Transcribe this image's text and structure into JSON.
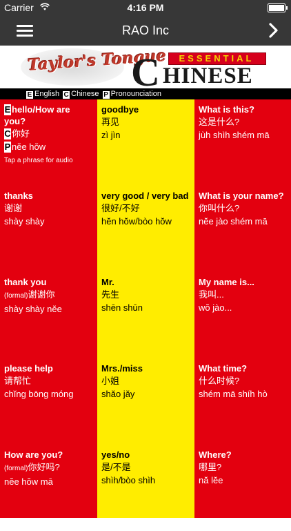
{
  "status": {
    "carrier": "Carrier",
    "time": "4:16 PM"
  },
  "nav": {
    "title": "RAO Inc"
  },
  "banner": {
    "logo": "Taylor's Tongue",
    "essential": "ESSENTIAL",
    "chinese_c": "C",
    "chinese_rest": "HINESE"
  },
  "legend": [
    {
      "key": "E",
      "label": "English"
    },
    {
      "key": "C",
      "label": "Chinese"
    },
    {
      "key": "P",
      "label": "Pronounciation"
    }
  ],
  "hint": "Tap a phrase for audio",
  "phrases": [
    [
      {
        "en": "hello/How are you?",
        "zh": "你好",
        "py": "nĕe hŏw"
      },
      {
        "en": "goodbye",
        "zh": "再见",
        "py": "zì jìn"
      },
      {
        "en": "What is this?",
        "zh": "这是什么?",
        "py": "jùh shìh shém mā"
      }
    ],
    [
      {
        "en": "thanks",
        "zh": "谢谢",
        "py": "shày shày"
      },
      {
        "en": "very good / very bad",
        "zh": "很好/不好",
        "py": "hĕn hŏw/bòo hŏw"
      },
      {
        "en": "What is your name?",
        "zh": "你叫什么?",
        "py": "nĕe jào shém mā"
      }
    ],
    [
      {
        "en": "thank you",
        "formal": "(formal)",
        "zh": "谢谢你",
        "py": "shày shày nĕe"
      },
      {
        "en": "Mr.",
        "zh": "先生",
        "py": "shēn shūn"
      },
      {
        "en": "My name is...",
        "zh": "我叫...",
        "py": "wŏ jào..."
      }
    ],
    [
      {
        "en": "please help",
        "zh": "请帮忙",
        "py": "chĭng bōng móng"
      },
      {
        "en": "Mrs./miss",
        "zh": "小姐",
        "py": "shăo jăy"
      },
      {
        "en": "What time?",
        "zh": "什么时候?",
        "py": "shém mā shíh hò"
      }
    ],
    [
      {
        "en": "How are you?",
        "formal": "(formal)",
        "zh": "你好吗?",
        "py": "nĕe hŏw mā"
      },
      {
        "en": "yes/no",
        "zh": "是/不是",
        "py": "shìh/bòo shìh"
      },
      {
        "en": "Where?",
        "zh": "哪里?",
        "py": "nă lĕe"
      }
    ]
  ],
  "first_cell_keys": [
    "E",
    "C",
    "P"
  ],
  "colors": {
    "red": "#e3000f",
    "yellow": "#ffed00",
    "bar": "#373737"
  },
  "icons": {
    "menu": "hamburger-menu-icon",
    "next": "chevron-right-icon"
  }
}
